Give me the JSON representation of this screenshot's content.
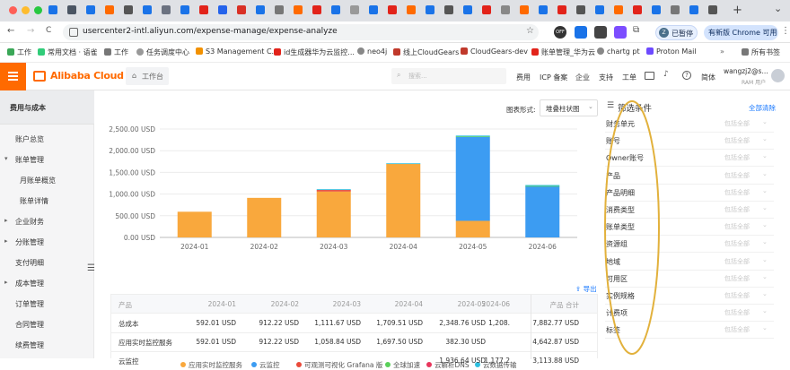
{
  "browser": {
    "tab_bar": {
      "new_tab": "+",
      "dropdown": "⌄"
    },
    "nav": {
      "back": "←",
      "forward": "→",
      "reload": "C"
    },
    "url": "usercenter2-intl.aliyun.com/expense-manage/expense-analyze",
    "paused_label": "已暂停",
    "update_label": "有新版 Chrome 可用",
    "bookmarks": [
      "工作",
      "常用文档 · 语雀",
      "工作",
      "任务调度中心",
      "S3 Management C...",
      "id生成器华为云监控...",
      "neo4j",
      "线上CloudGears",
      "CloudGears-dev",
      "账单管理_华为云",
      "chartg pt",
      "Proton Mail"
    ],
    "all_bookmarks": "所有书签"
  },
  "topnav": {
    "brand": "Alibaba Cloud",
    "workbench": "工作台",
    "search_placeholder": "搜索...",
    "links": [
      "费用",
      "ICP 备案",
      "企业",
      "支持",
      "工单"
    ],
    "lang": "简体",
    "user_name": "wangzj2@s...",
    "user_role": "RAM 用户"
  },
  "sidebar": {
    "header": "费用与成本",
    "items": [
      {
        "label": "账户总览",
        "arrow": ""
      },
      {
        "label": "账单管理",
        "arrow": "▾"
      },
      {
        "label": "月账单概览",
        "arrow": ""
      },
      {
        "label": "账单详情",
        "arrow": ""
      },
      {
        "label": "企业财务",
        "arrow": "▸"
      },
      {
        "label": "分账管理",
        "arrow": "▸"
      },
      {
        "label": "支付明细",
        "arrow": ""
      },
      {
        "label": "成本管理",
        "arrow": "▸"
      },
      {
        "label": "订单管理",
        "arrow": ""
      },
      {
        "label": "合同管理",
        "arrow": ""
      },
      {
        "label": "续费管理",
        "arrow": ""
      }
    ]
  },
  "chart_form": {
    "label": "图表形式:",
    "value": "堆叠柱状图"
  },
  "chart_data": {
    "type": "bar",
    "stacked": true,
    "categories": [
      "2024-01",
      "2024-02",
      "2024-03",
      "2024-04",
      "2024-05",
      "2024-06"
    ],
    "y_ticks": [
      "2,500.00 USD",
      "2,000.00 USD",
      "1,500.00 USD",
      "1,000.00 USD",
      "500.00 USD",
      "0.00 USD"
    ],
    "ylim": [
      0,
      2500
    ],
    "series": [
      {
        "name": "应用实时监控服务",
        "color": "#f9a83d",
        "values": [
          592.01,
          912.22,
          1058.84,
          1697.5,
          382.3,
          0
        ]
      },
      {
        "name": "云监控",
        "color": "#3c9cf2",
        "values": [
          0,
          0,
          0,
          0,
          1936.64,
          1177.23
        ]
      },
      {
        "name": "可观测可视化 Grafana 版",
        "color": "#ea4a3a",
        "values": [
          0,
          0,
          35,
          0,
          0,
          0
        ]
      },
      {
        "name": "全球加速",
        "color": "#5ad05a",
        "values": [
          0,
          0,
          0,
          0,
          15,
          10
        ]
      },
      {
        "name": "云解析DNS",
        "color": "#e8365c",
        "values": [
          0,
          0,
          0,
          0,
          0,
          0
        ]
      },
      {
        "name": "云数据传输",
        "color": "#2fc0e0",
        "values": [
          0,
          0,
          17.83,
          12.01,
          15,
          21
        ]
      }
    ],
    "grid": true,
    "legend": "bottom"
  },
  "export_label": "导出",
  "table": {
    "headers": [
      "产品",
      "2024-01",
      "2024-02",
      "2024-03",
      "2024-04",
      "2024-05",
      "2024-06",
      "产品 合计"
    ],
    "rows": [
      [
        "总成本",
        "592.01 USD",
        "912.22 USD",
        "1,111.67 USD",
        "1,709.51 USD",
        "2,348.76 USD",
        "1,208.",
        "7,882.77 USD"
      ],
      [
        "应用实时监控服务",
        "592.01 USD",
        "912.22 USD",
        "1,058.84 USD",
        "1,697.50 USD",
        "382.30 USD",
        "",
        "4,642.87 USD"
      ],
      [
        "云监控",
        "",
        "",
        "",
        "",
        "1,936.64 USD",
        "1,177.2",
        "3,113.88 USD"
      ]
    ]
  },
  "filter": {
    "title": "筛选条件",
    "clear": "全部清除",
    "placeholder": "包括全部",
    "rows": [
      "财务单元",
      "账号",
      "Owner账号",
      "产品",
      "产品明细",
      "消费类型",
      "账单类型",
      "资源组",
      "地域",
      "可用区",
      "实例规格",
      "计费项",
      "标签"
    ]
  }
}
